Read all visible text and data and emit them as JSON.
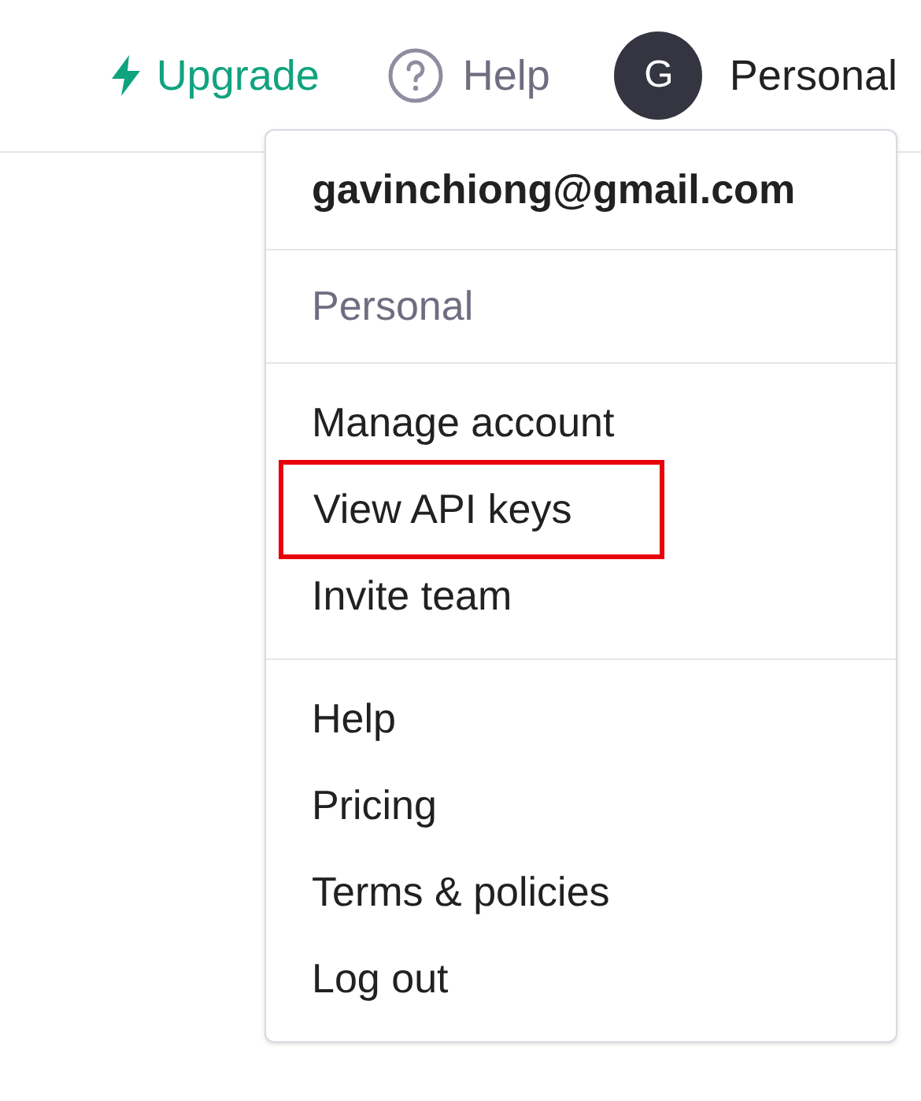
{
  "header": {
    "upgrade": "Upgrade",
    "help": "Help",
    "avatar_initial": "G",
    "account": "Personal"
  },
  "menu": {
    "email": "gavinchiong@gmail.com",
    "workspace": "Personal",
    "groups": [
      [
        {
          "label": "Manage account",
          "highlighted": false
        },
        {
          "label": "View API keys",
          "highlighted": true
        },
        {
          "label": "Invite team",
          "highlighted": false
        }
      ],
      [
        {
          "label": "Help",
          "highlighted": false
        },
        {
          "label": "Pricing",
          "highlighted": false
        },
        {
          "label": "Terms & policies",
          "highlighted": false
        },
        {
          "label": "Log out",
          "highlighted": false
        }
      ]
    ]
  }
}
